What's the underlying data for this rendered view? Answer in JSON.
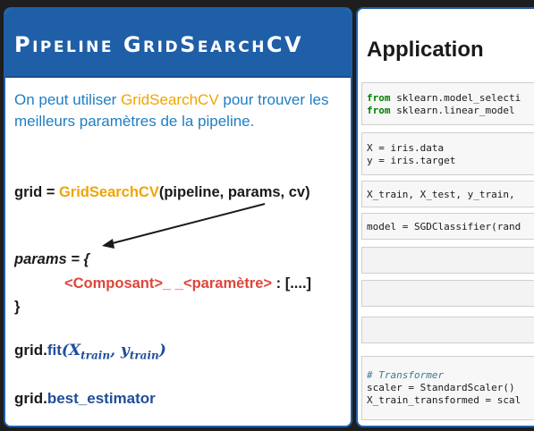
{
  "left": {
    "title": "Pipeline GridSearchCV",
    "intro": {
      "part1": "On peut utiliser ",
      "highlight": "GridSearchCV",
      "part2": " pour trouver les meilleurs paramètres de la pipeline."
    },
    "grid_line": {
      "prefix": "grid = ",
      "func": "GridSearchCV",
      "args": "(pipeline, params, cv)"
    },
    "params_open": "params = {",
    "params_body": {
      "component": "<Composant>",
      "separator": "_ _",
      "param": "<paramètre>",
      "rest": " : [....]"
    },
    "params_close": "}",
    "fit_line": {
      "prefix": "grid.",
      "method": "fit",
      "open": "(",
      "x_var": "X",
      "x_sub": "train",
      "comma": ", ",
      "y_var": "y",
      "y_sub": "train",
      "close": ")"
    },
    "best_line": {
      "prefix": "grid.",
      "attr": "best_estimator"
    }
  },
  "right": {
    "title": "Application",
    "cells": [
      {
        "lines": [
          {
            "kw": "from",
            "text": " sklearn.model_selecti"
          },
          {
            "kw": "from",
            "text": " sklearn.linear_model "
          }
        ]
      },
      {
        "lines": [
          {
            "kw": "",
            "text": "X = iris.data"
          },
          {
            "kw": "",
            "text": "y = iris.target"
          }
        ]
      },
      {
        "lines": [
          {
            "kw": "",
            "text": "X_train, X_test, y_train, "
          }
        ]
      },
      {
        "lines": [
          {
            "kw": "",
            "text": "model = SGDClassifier(rand"
          }
        ]
      },
      {
        "lines": []
      },
      {
        "lines": []
      },
      {
        "lines": []
      },
      {
        "lines": [
          {
            "kw": "",
            "comment": "# Transformer",
            "text": ""
          },
          {
            "kw": "",
            "text": "scaler = StandardScaler()"
          },
          {
            "kw": "",
            "text": "X_train_transformed = scal"
          }
        ]
      }
    ]
  },
  "colors": {
    "header_blue": "#1f5fa8",
    "intro_blue": "#1f7ec2",
    "highlight_orange": "#f0a500",
    "param_red": "#e0453a"
  }
}
